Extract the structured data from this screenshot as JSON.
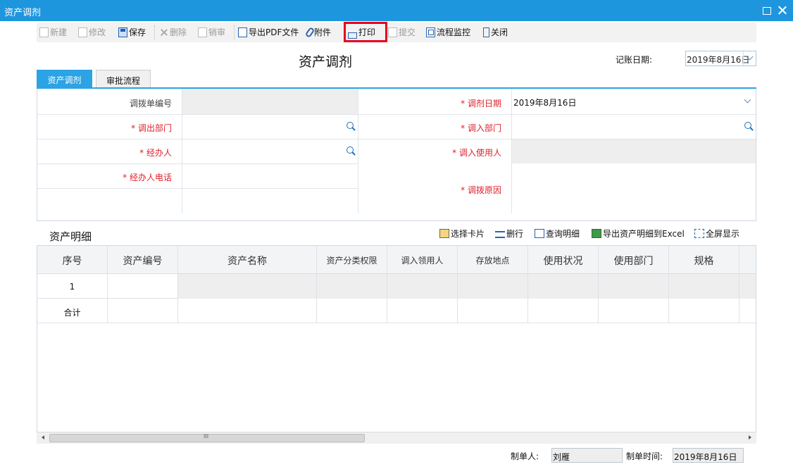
{
  "window": {
    "title": "资产调剂"
  },
  "toolbar": {
    "new": "新建",
    "edit": "修改",
    "save": "保存",
    "delete": "删除",
    "cancel_review": "销审",
    "export_pdf": "导出PDF文件",
    "attachment": "附件",
    "print": "打印",
    "submit": "提交",
    "process_monitor": "流程监控",
    "close": "关闭"
  },
  "header": {
    "title": "资产调剂",
    "date_label": "记账日期:",
    "date_value": "2019年8月16日"
  },
  "tabs": {
    "asset_transfer": "资产调剂",
    "approval_flow": "审批流程"
  },
  "form": {
    "transfer_no_label": "调拨单编号",
    "transfer_date_label": "调剂日期",
    "transfer_date_value": "2019年8月16日",
    "out_dept_label": "调出部门",
    "in_dept_label": "调入部门",
    "handler_label": "经办人",
    "in_user_label": "调入使用人",
    "handler_phone_label": "经办人电话",
    "reason_label": "调拨原因",
    "required_mark": "*"
  },
  "details": {
    "title": "资产明细",
    "select_card": "选择卡片",
    "delete_row": "删行",
    "query_detail": "查询明细",
    "export_excel": "导出资产明细到Excel",
    "fullscreen": "全屏显示"
  },
  "grid": {
    "columns": [
      "序号",
      "资产编号",
      "资产名称",
      "资产分类权限",
      "调入领用人",
      "存放地点",
      "使用状况",
      "使用部门",
      "规格"
    ],
    "row1_index": "1",
    "total_label": "合计"
  },
  "footer": {
    "maker_label": "制单人:",
    "maker_value": "刘雁",
    "make_time_label": "制单时间:",
    "make_time_value": "2019年8月16日"
  },
  "colors": {
    "titlebar": "#1e96dd",
    "tab_active": "#2ba3e4",
    "required": "#e0212b",
    "highlight": "#e8001c"
  }
}
